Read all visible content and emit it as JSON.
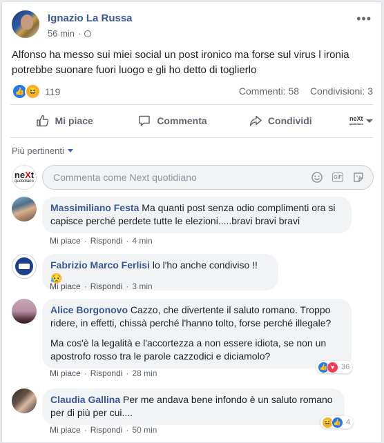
{
  "post": {
    "author": "Ignazio La Russa",
    "time": "56 min",
    "privacy_icon": "globe-icon",
    "text": "Alfonso ha messo sui miei social un post ironico ma forse sul virus l ironia potrebbe suonare fuori luogo e gli ho detto di toglierlo",
    "reactions_count": "119",
    "comments_count": "Commenti: 58",
    "shares_count": "Condivisioni: 3"
  },
  "actions": {
    "like": "Mi piace",
    "comment": "Commenta",
    "share": "Condividi"
  },
  "page_logo": {
    "line1": "neXt",
    "line2": "quotidiano"
  },
  "filter": {
    "label": "Più pertinenti"
  },
  "composer": {
    "placeholder": "Commenta come Next quotidiano"
  },
  "comments": [
    {
      "name": "Massimiliano Festa",
      "text": "Ma quanti post senza odio complimenti ora si capisce perché perdete tutte le elezioni.....bravi bravi bravi",
      "like": "Mi piace",
      "reply": "Rispondi",
      "time": "4 min"
    },
    {
      "name": "Fabrizio Marco Ferlisi",
      "text": "lo l'ho anche condiviso !! 😥",
      "like": "Mi piace",
      "reply": "Rispondi",
      "time": "3 min"
    },
    {
      "name": "Alice Borgonovo",
      "text": "Cazzo, che divertente il saluto romano. Troppo ridere, in effetti, chissà perché l'hanno tolto, forse perché illegale?",
      "text2": "Ma cos'è la legalità e l'accortezza a non essere idiota, se non un apostrofo rosso tra le parole cazzodici e diciamolo?",
      "like": "Mi piace",
      "reply": "Rispondi",
      "time": "28 min",
      "reactions": "36"
    },
    {
      "name": "Claudia Gallina",
      "text": "Per me andava bene infondo è un saluto romano per di più per cui....",
      "like": "Mi piace",
      "reply": "Rispondi",
      "time": "50 min",
      "reactions": "4"
    }
  ],
  "colors": {
    "link": "#385898",
    "like": "#2078f4",
    "love": "#f33e58",
    "haha": "#f7b125"
  }
}
